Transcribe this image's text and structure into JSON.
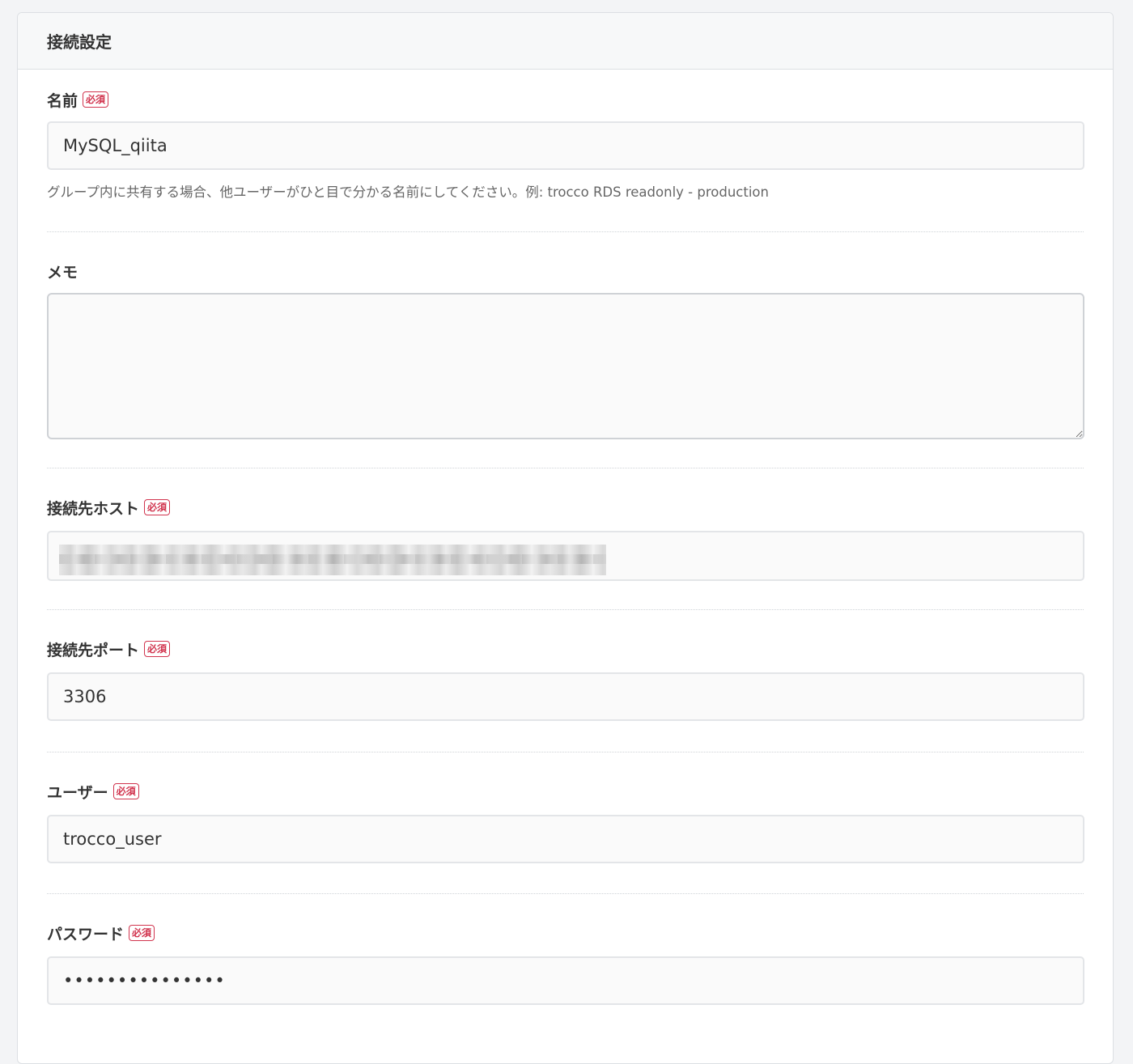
{
  "header": {
    "title": "接続設定"
  },
  "required_badge": "必須",
  "fields": {
    "name": {
      "label": "名前",
      "value": "MySQL_qiita",
      "help": "グループ内に共有する場合、他ユーザーがひと目で分かる名前にしてください。例: trocco RDS readonly - production"
    },
    "memo": {
      "label": "メモ",
      "value": ""
    },
    "host": {
      "label": "接続先ホスト",
      "value": ""
    },
    "port": {
      "label": "接続先ポート",
      "value": "3306"
    },
    "user": {
      "label": "ユーザー",
      "value": "trocco_user"
    },
    "password": {
      "label": "パスワード",
      "value": "•••••••••••••••"
    }
  },
  "colors": {
    "required": "#d1344e",
    "border": "#e3e5e8"
  }
}
